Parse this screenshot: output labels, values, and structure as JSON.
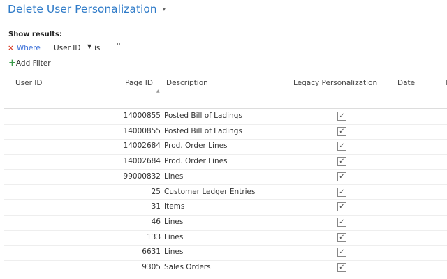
{
  "title": "Delete User Personalization",
  "filters": {
    "show_results": "Show results:",
    "remove_icon": "×",
    "where": "Where",
    "field": "User ID",
    "is": "is",
    "value": "''",
    "add_filter": "Add Filter"
  },
  "columns": [
    "User ID",
    "Page ID",
    "Description",
    "Legacy Personalization",
    "Date",
    "T"
  ],
  "sort_column": "Page ID",
  "rows": [
    {
      "user_id": "",
      "page_id": "14000855",
      "description": "Posted Bill of Ladings",
      "legacy": true
    },
    {
      "user_id": "",
      "page_id": "14000855",
      "description": "Posted Bill of Ladings",
      "legacy": true
    },
    {
      "user_id": "",
      "page_id": "14002684",
      "description": "Prod. Order Lines",
      "legacy": true
    },
    {
      "user_id": "",
      "page_id": "14002684",
      "description": "Prod. Order Lines",
      "legacy": true
    },
    {
      "user_id": "",
      "page_id": "99000832",
      "description": "Lines",
      "legacy": true
    },
    {
      "user_id": "",
      "page_id": "25",
      "description": "Customer Ledger Entries",
      "legacy": true
    },
    {
      "user_id": "",
      "page_id": "31",
      "description": "Items",
      "legacy": true
    },
    {
      "user_id": "",
      "page_id": "46",
      "description": "Lines",
      "legacy": true
    },
    {
      "user_id": "",
      "page_id": "133",
      "description": "Lines",
      "legacy": true
    },
    {
      "user_id": "",
      "page_id": "6631",
      "description": "Lines",
      "legacy": true
    },
    {
      "user_id": "",
      "page_id": "9305",
      "description": "Sales Orders",
      "legacy": true
    }
  ]
}
